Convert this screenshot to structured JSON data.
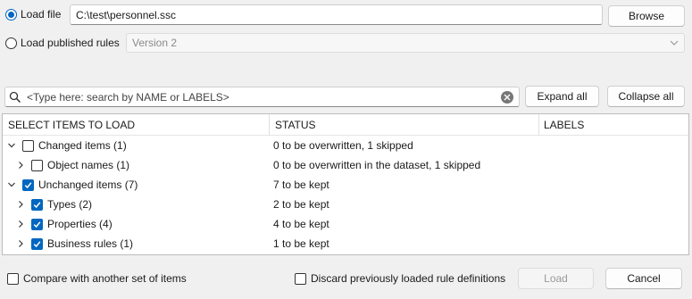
{
  "load_file": {
    "label": "Load file",
    "path": "C:\\test\\personnel.ssc",
    "browse_label": "Browse"
  },
  "load_published": {
    "label": "Load published rules",
    "version": "Version 2"
  },
  "search": {
    "placeholder": "<Type here: search by NAME or LABELS>"
  },
  "toolbar": {
    "expand_all": "Expand all",
    "collapse_all": "Collapse all"
  },
  "columns": {
    "items": "SELECT ITEMS TO LOAD",
    "status": "STATUS",
    "labels": "LABELS"
  },
  "tree": [
    {
      "label": "Changed items (1)",
      "status": "0 to be overwritten, 1 skipped",
      "checked": false,
      "expanded": true,
      "level": 0
    },
    {
      "label": "Object names (1)",
      "status": "0 to be overwritten in the dataset, 1 skipped",
      "checked": false,
      "expanded": false,
      "level": 1
    },
    {
      "label": "Unchanged items (7)",
      "status": "7 to be kept",
      "checked": true,
      "expanded": true,
      "level": 0
    },
    {
      "label": "Types (2)",
      "status": "2 to be kept",
      "checked": true,
      "expanded": false,
      "level": 1
    },
    {
      "label": "Properties (4)",
      "status": "4 to be kept",
      "checked": true,
      "expanded": false,
      "level": 1
    },
    {
      "label": "Business rules (1)",
      "status": "1 to be kept",
      "checked": true,
      "expanded": false,
      "level": 1
    }
  ],
  "footer": {
    "compare_label": "Compare with another set of items",
    "discard_label": "Discard previously loaded rule definitions",
    "load_label": "Load",
    "cancel_label": "Cancel"
  },
  "colors": {
    "accent": "#0067c0"
  }
}
